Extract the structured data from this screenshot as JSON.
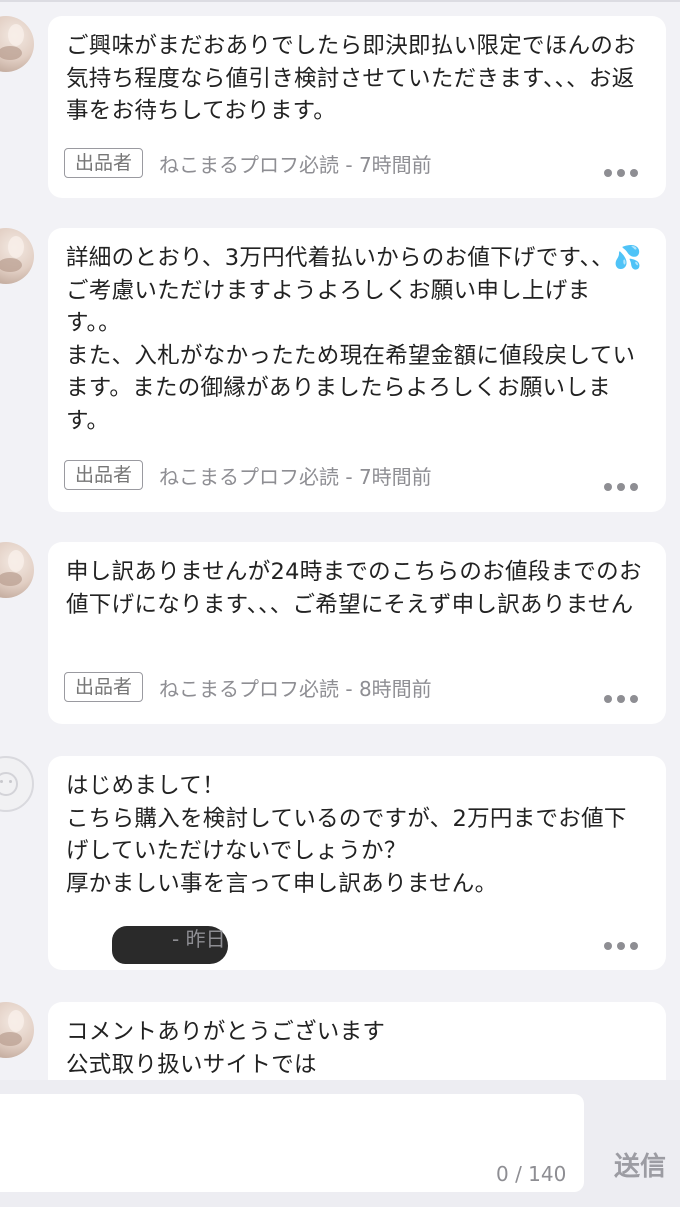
{
  "comments": [
    {
      "text": "ご興味がまだおありでしたら即決即払い限定でほんのお気持ち程度なら値引き検討させていただきます、、、お返事をお待ちしております。",
      "badge": "出品者",
      "meta": "ねこまるプロフ必読 - 7時間前"
    },
    {
      "text_a": "詳細のとおり、3万円代着払いからのお値下げです、、",
      "emoji": "💦",
      "text_b": "ご考慮いただけますようよろしくお願い申し上げます。。\nまた、入札がなかったため現在希望金額に値段戻しています。またの御縁がありましたらよろしくお願いします。",
      "badge": "出品者",
      "meta": "ねこまるプロフ必読 - 7時間前"
    },
    {
      "text": "申し訳ありませんが24時までのこちらのお値段までのお値下げになります、、、ご希望にそえず申し訳ありません",
      "badge": "出品者",
      "meta": "ねこまるプロフ必読 - 8時間前"
    },
    {
      "text": "はじめまして！\nこちら購入を検討しているのですが、2万円までお値下げしていただけないでしょうか？\n厚かましい事を言って申し訳ありません。",
      "meta": "- 昨日"
    },
    {
      "text": "コメントありがとうございます\n公式取り扱いサイトでは"
    }
  ],
  "composer": {
    "placeholder": "",
    "counter": "0 / 140",
    "send_label": "送信"
  },
  "icons": {
    "more": "more-horizontal-icon",
    "avatar_default": "default-avatar-icon"
  },
  "colors": {
    "background": "#f2f2f6",
    "bubble": "#ffffff",
    "muted": "#8e8e93"
  }
}
